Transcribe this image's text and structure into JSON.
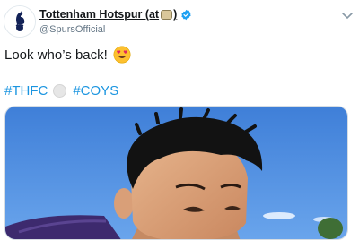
{
  "tweet": {
    "author": {
      "display_name": "Tottenham Hotspur (at",
      "display_name_close": ")",
      "handle": "@SpursOfficial",
      "verified": true,
      "avatar": "spurs-cockerel-logo"
    },
    "text": "Look who’s back!",
    "text_emoji": "heart-eyes-emoji",
    "hashtags": [
      "#THFC",
      "#COYS"
    ],
    "hashtag_separator_emoji": "white-circle-emoji",
    "media": {
      "type": "photo",
      "subject": "person-selfie-outdoors"
    },
    "menu_icon": "chevron-down-icon"
  },
  "colors": {
    "link": "#1b95e0",
    "verified": "#1da1f2",
    "text": "#14171a",
    "secondary_text": "#657786",
    "sky": "#4f8fe0",
    "jacket": "#3d2a6e"
  }
}
